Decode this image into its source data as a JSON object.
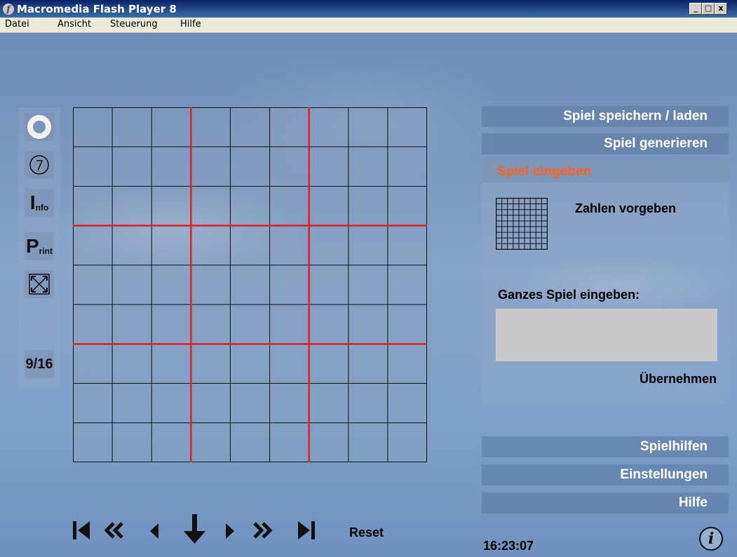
{
  "window": {
    "title": "Macromedia Flash Player 8",
    "app_icon": "flash-icon",
    "controls": {
      "minimize": "_",
      "maximize": "□",
      "close": "x"
    }
  },
  "menubar": {
    "items": [
      {
        "label": "Datei"
      },
      {
        "label": "Ansicht"
      },
      {
        "label": "Steuerung"
      },
      {
        "label": "Hilfe"
      }
    ]
  },
  "toolbar": {
    "items": [
      {
        "name": "ring-icon"
      },
      {
        "name": "timer-icon"
      },
      {
        "name": "info-tool",
        "big": "I",
        "small": "nfo"
      },
      {
        "name": "print-tool",
        "big": "P",
        "small": "rint"
      },
      {
        "name": "fullscreen-icon"
      },
      {
        "name": "size-toggle",
        "label": "9/16"
      }
    ]
  },
  "board": {
    "rows": 9,
    "cols": 9,
    "box_every": 3,
    "box_line_color": "#e02020",
    "cell_line_color": "#111111"
  },
  "right_panel": {
    "save_load": "Spiel speichern / laden",
    "generate": "Spiel generieren",
    "enter": "Spiel eingeben",
    "zahlen": "Zahlen vorgeben",
    "ganzes": "Ganzes Spiel eingeben:",
    "ganzes_value": "",
    "uebernehmen": "Übernehmen",
    "hints": "Spielhilfen",
    "settings": "Einstellungen",
    "help": "Hilfe"
  },
  "nav": {
    "buttons": [
      "first-icon",
      "rewind-icon",
      "prev-icon",
      "down-arrow-icon",
      "next-icon",
      "fast-forward-icon",
      "last-icon"
    ],
    "reset": "Reset"
  },
  "status": {
    "clock": "16:23:07"
  },
  "colors": {
    "accent_orange": "#ff5f1f",
    "panel_button": "#5a78a0",
    "input_gray": "#c9c9c9"
  }
}
